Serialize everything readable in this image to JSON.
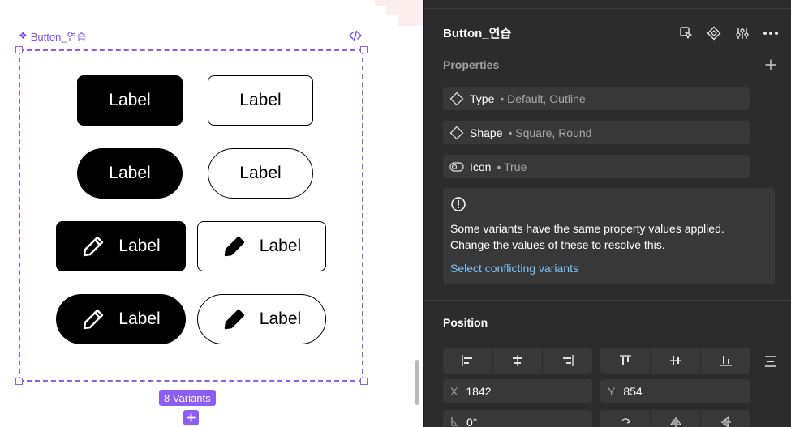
{
  "canvas": {
    "component_name": "Button_연습",
    "variants_badge": "8 Variants",
    "buttons": [
      {
        "label": "Label",
        "type": "filled",
        "shape": "square",
        "icon": false
      },
      {
        "label": "Label",
        "type": "outline",
        "shape": "square",
        "icon": false
      },
      {
        "label": "Label",
        "type": "filled",
        "shape": "round",
        "icon": false
      },
      {
        "label": "Label",
        "type": "outline",
        "shape": "round",
        "icon": false
      },
      {
        "label": "Label",
        "type": "filled",
        "shape": "square",
        "icon": true
      },
      {
        "label": "Label",
        "type": "outline",
        "shape": "square",
        "icon": true
      },
      {
        "label": "Label",
        "type": "filled",
        "shape": "round",
        "icon": true
      },
      {
        "label": "Label",
        "type": "outline",
        "shape": "round",
        "icon": true
      }
    ]
  },
  "panel": {
    "title": "Button_연습",
    "properties_heading": "Properties",
    "properties": [
      {
        "name": "Type",
        "values": "• Default, Outline",
        "icon": "diamond-icon"
      },
      {
        "name": "Shape",
        "values": "• Square, Round",
        "icon": "diamond-icon"
      },
      {
        "name": "Icon",
        "values": "• True",
        "icon": "toggle-icon"
      }
    ],
    "conflict": {
      "message": "Some variants have the same property values applied. Change the values of these to resolve this.",
      "link": "Select conflicting variants"
    },
    "position_heading": "Position",
    "x_label": "X",
    "x_value": "1842",
    "y_label": "Y",
    "y_value": "854",
    "rotation_value": "0°"
  },
  "colors": {
    "accent": "#8b5cf6",
    "panel_bg": "#2c2c2c",
    "field_bg": "#383838",
    "link": "#7cc4fa"
  }
}
